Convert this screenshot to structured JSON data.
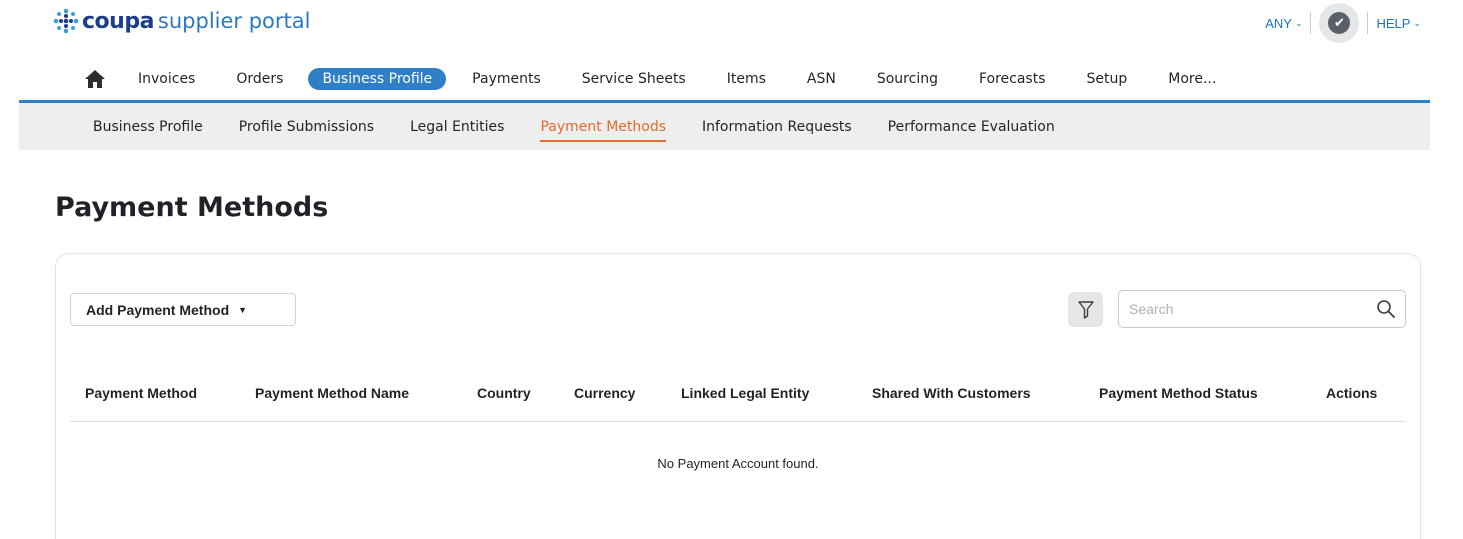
{
  "brand": {
    "name": "coupa",
    "product": "supplier portal"
  },
  "top_right": {
    "any_label": "ANY",
    "help_label": "HELP"
  },
  "main_nav": {
    "items": [
      "Invoices",
      "Orders",
      "Business Profile",
      "Payments",
      "Service Sheets",
      "Items",
      "ASN",
      "Sourcing",
      "Forecasts",
      "Setup",
      "More..."
    ],
    "active": "Business Profile"
  },
  "sub_nav": {
    "items": [
      "Business Profile",
      "Profile Submissions",
      "Legal Entities",
      "Payment Methods",
      "Information Requests",
      "Performance Evaluation"
    ],
    "active": "Payment Methods"
  },
  "page": {
    "title": "Payment Methods"
  },
  "toolbar": {
    "add_label": "Add Payment Method",
    "search_placeholder": "Search"
  },
  "table": {
    "columns": [
      "Payment Method",
      "Payment Method Name",
      "Country",
      "Currency",
      "Linked Legal Entity",
      "Shared With Customers",
      "Payment Method Status",
      "Actions"
    ],
    "empty_message": "No Payment Account found."
  },
  "colors": {
    "brand_blue": "#2f7fc6",
    "link_blue": "#1a73c9",
    "active_orange": "#e06c2f",
    "logo_navy": "#1a3e8a"
  },
  "icons": {
    "logo": "coupa-snowflake-icon",
    "home": "home-icon",
    "notification": "check-circle-icon",
    "filter": "filter-icon",
    "search": "search-icon"
  }
}
